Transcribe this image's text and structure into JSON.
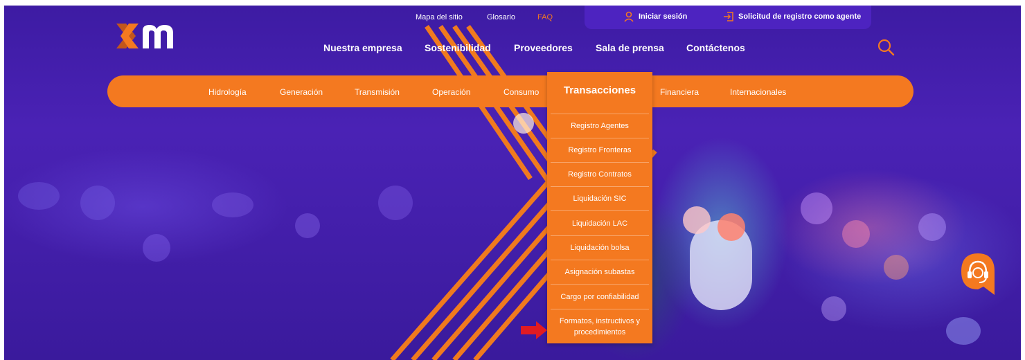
{
  "top_links": {
    "site_map": "Mapa del sitio",
    "glossary": "Glosario",
    "faq": "FAQ"
  },
  "account": {
    "login": "Iniciar sesión",
    "register": "Solicitud de registro como agente"
  },
  "main_nav": [
    "Nuestra empresa",
    "Sostenibilidad",
    "Proveedores",
    "Sala de prensa",
    "Contáctenos"
  ],
  "sub_nav": [
    "Hidrología",
    "Generación",
    "Transmisión",
    "Operación",
    "Consumo",
    "Transacciones",
    "Financiera",
    "Internacionales"
  ],
  "dropdown": {
    "title": "Transacciones",
    "items": [
      "Registro Agentes",
      "Registro Fronteras",
      "Registro Contratos",
      "Liquidación SIC",
      "Liquidación LAC",
      "Liquidación bolsa",
      "Asignación subastas",
      "Cargo por confiabilidad",
      "Formatos, instructivos y procedimientos"
    ]
  },
  "colors": {
    "brand_orange": "#f47920",
    "brand_purple": "#4d23c0",
    "annotation_arrow": "#e11b22"
  },
  "icons": {
    "logo": "xm-logo",
    "search": "search-icon",
    "user": "user-icon",
    "register": "sign-in-icon",
    "chat": "support-headset-icon",
    "arrow": "red-arrow-icon"
  }
}
